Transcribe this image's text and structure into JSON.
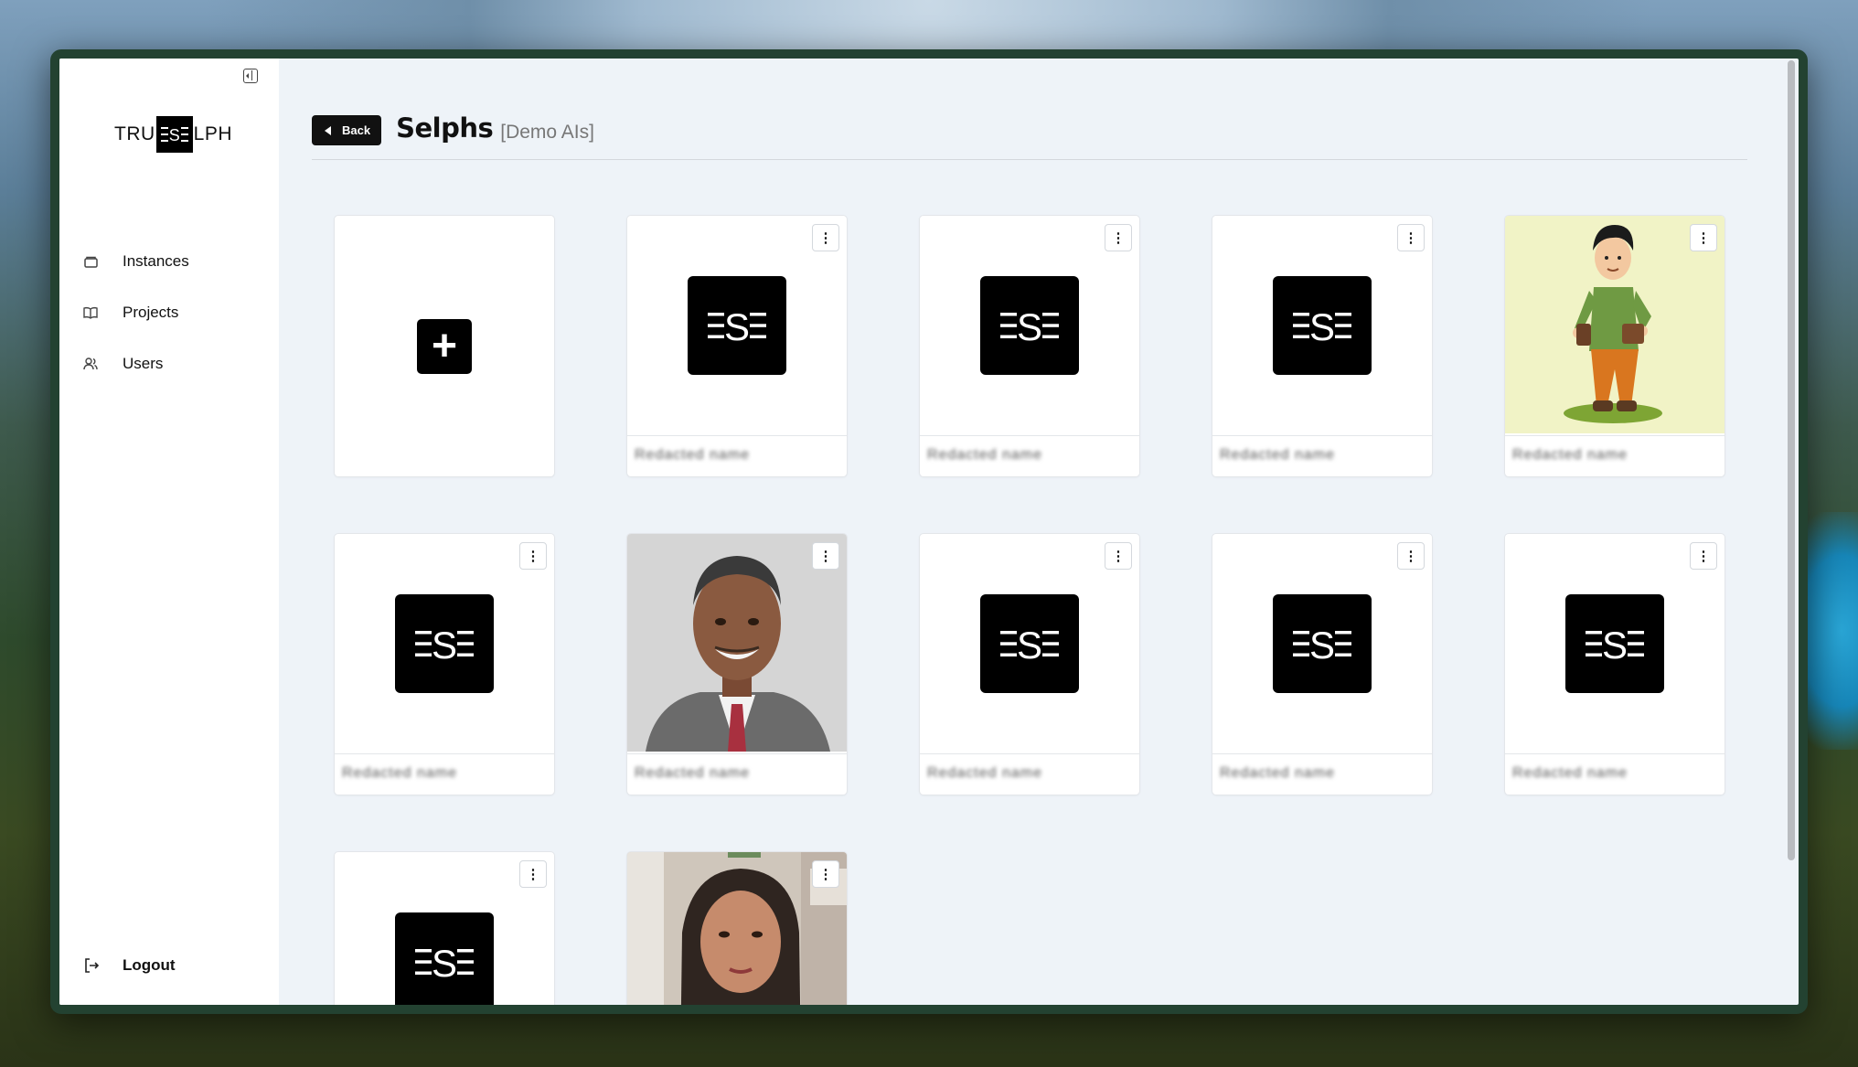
{
  "sidebar": {
    "logo_left": "TRU",
    "logo_mark": "ESE",
    "logo_right": "LPH",
    "items": [
      {
        "label": "Instances",
        "icon": "box-icon"
      },
      {
        "label": "Projects",
        "icon": "book-icon"
      },
      {
        "label": "Users",
        "icon": "users-icon"
      }
    ],
    "logout_label": "Logout"
  },
  "header": {
    "back_label": "Back",
    "title": "Selphs",
    "subtitle": "[Demo AIs]"
  },
  "cards": [
    {
      "type": "add"
    },
    {
      "type": "logo",
      "name": "Redacted name"
    },
    {
      "type": "logo",
      "name": "Redacted name"
    },
    {
      "type": "logo",
      "name": "Redacted name"
    },
    {
      "type": "cartoon",
      "name": "Redacted name"
    },
    {
      "type": "logo",
      "name": "Redacted name"
    },
    {
      "type": "portrait-man",
      "name": "Redacted name"
    },
    {
      "type": "logo",
      "name": "Redacted name"
    },
    {
      "type": "logo",
      "name": "Redacted name"
    },
    {
      "type": "logo",
      "name": "Redacted name"
    },
    {
      "type": "logo",
      "name": ""
    },
    {
      "type": "portrait-woman",
      "name": ""
    }
  ],
  "colors": {
    "accent": "#111111",
    "page_bg": "#eef3f8",
    "sidebar_bg": "#ffffff"
  }
}
